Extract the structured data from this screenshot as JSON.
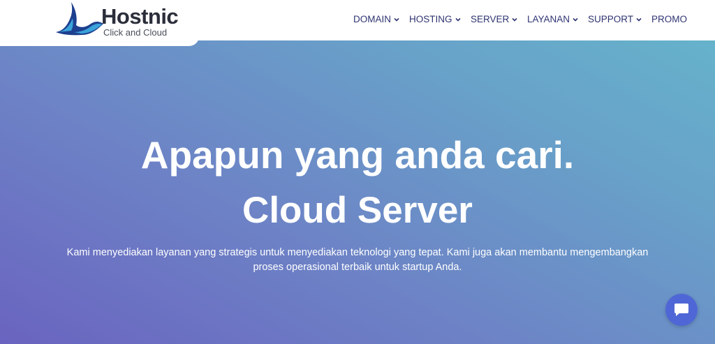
{
  "brand": {
    "name": "Hostnic",
    "tagline": "Click and Cloud",
    "logo_icon": "wave-logo-icon",
    "colors": {
      "wave_dark": "#1d3f8f",
      "wave_light": "#3aa3d9",
      "text": "#2b2e3a"
    }
  },
  "nav": {
    "items": [
      {
        "label": "DOMAIN",
        "has_dropdown": true
      },
      {
        "label": "HOSTING",
        "has_dropdown": true
      },
      {
        "label": "SERVER",
        "has_dropdown": true
      },
      {
        "label": "LAYANAN",
        "has_dropdown": true
      },
      {
        "label": "SUPPORT",
        "has_dropdown": true
      },
      {
        "label": "PROMO",
        "has_dropdown": false
      }
    ],
    "color": "#2f3472"
  },
  "hero": {
    "title": "Apapun yang anda cari.",
    "subtitle": "Cloud Server",
    "description": "Kami menyediakan layanan yang strategis untuk menyediakan teknologi yang tepat. Kami juga akan membantu mengembangkan proses operasional terbaik untuk startup Anda.",
    "gradient": [
      "#6a64c0",
      "#66b2cb"
    ]
  },
  "chat": {
    "icon": "chat-bubble-icon",
    "color": "#4f67d6"
  }
}
